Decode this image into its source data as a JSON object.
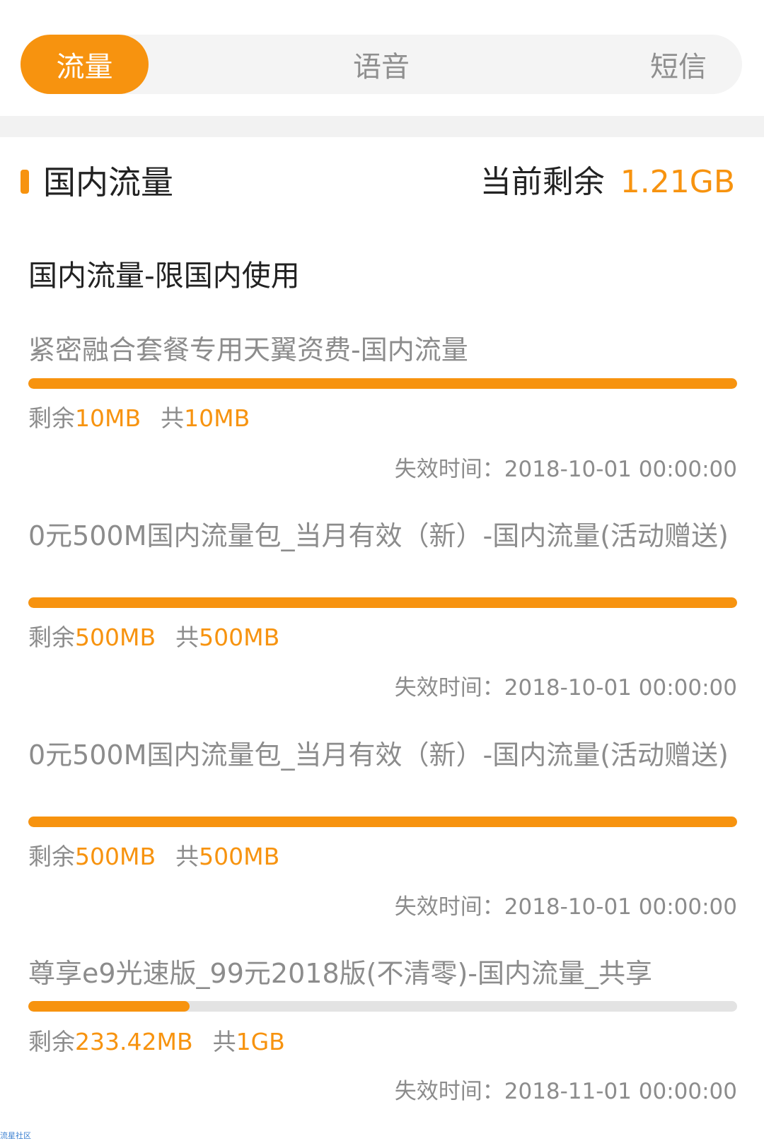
{
  "tabs": [
    {
      "label": "流量",
      "active": true
    },
    {
      "label": "语音",
      "active": false
    },
    {
      "label": "短信",
      "active": false
    }
  ],
  "section": {
    "title": "国内流量",
    "remaining_label": "当前剩余",
    "remaining_value": "1.21GB"
  },
  "subheading": "国内流量-限国内使用",
  "packages": [
    {
      "name": "紧密融合套餐专用天翼资费-国内流量",
      "remaining_label": "剩余",
      "remaining": "10MB",
      "total_label": "共",
      "total": "10MB",
      "remaining_fraction": 1.0,
      "expiry_label": "失效时间：",
      "expiry": "2018-10-01 00:00:00"
    },
    {
      "name": "0元500M国内流量包_当月有效（新）-国内流量(活动赠送)",
      "remaining_label": "剩余",
      "remaining": "500MB",
      "total_label": "共",
      "total": "500MB",
      "remaining_fraction": 1.0,
      "expiry_label": "失效时间：",
      "expiry": "2018-10-01 00:00:00"
    },
    {
      "name": "0元500M国内流量包_当月有效（新）-国内流量(活动赠送)",
      "remaining_label": "剩余",
      "remaining": "500MB",
      "total_label": "共",
      "total": "500MB",
      "remaining_fraction": 1.0,
      "expiry_label": "失效时间：",
      "expiry": "2018-10-01 00:00:00"
    },
    {
      "name": "尊享e9光速版_99元2018版(不清零)-国内流量_共享",
      "remaining_label": "剩余",
      "remaining": "233.42MB",
      "total_label": "共",
      "total": "1GB",
      "remaining_fraction": 0.228,
      "expiry_label": "失效时间：",
      "expiry": "2018-11-01 00:00:00"
    }
  ],
  "watermark": "流星社区",
  "colors": {
    "accent": "#f7930f",
    "muted_text": "#8c8c8c",
    "track": "#e3e3e3"
  }
}
